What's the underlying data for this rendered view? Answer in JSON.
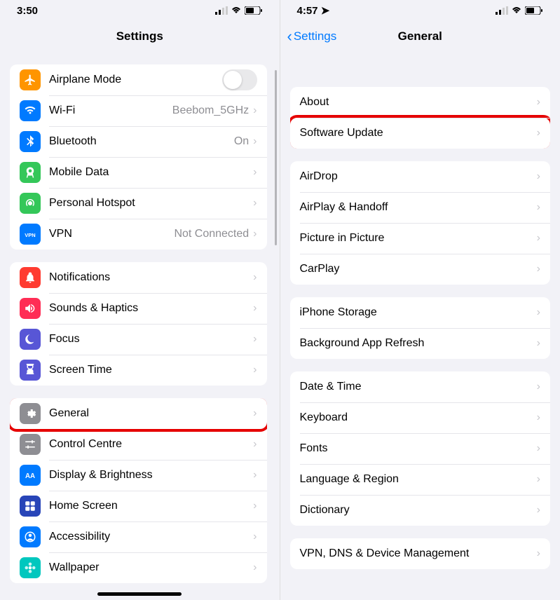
{
  "left": {
    "status_time": "3:50",
    "nav_title": "Settings",
    "groups": [
      {
        "rows": [
          {
            "key": "airplane",
            "label": "Airplane Mode",
            "icon": "airplane",
            "bg": "#ff9500",
            "control": "switch"
          },
          {
            "key": "wifi",
            "label": "Wi-Fi",
            "icon": "wifi",
            "bg": "#007aff",
            "value": "Beebom_5GHz",
            "chevron": true
          },
          {
            "key": "bluetooth",
            "label": "Bluetooth",
            "icon": "bluetooth",
            "bg": "#007aff",
            "value": "On",
            "chevron": true
          },
          {
            "key": "mobile-data",
            "label": "Mobile Data",
            "icon": "antenna",
            "bg": "#34c759",
            "chevron": true
          },
          {
            "key": "hotspot",
            "label": "Personal Hotspot",
            "icon": "hotspot",
            "bg": "#34c759",
            "chevron": true
          },
          {
            "key": "vpn",
            "label": "VPN",
            "icon": "vpn",
            "bg": "#007aff",
            "value": "Not Connected",
            "chevron": true
          }
        ]
      },
      {
        "rows": [
          {
            "key": "notifications",
            "label": "Notifications",
            "icon": "bell",
            "bg": "#ff3b30",
            "chevron": true
          },
          {
            "key": "sounds",
            "label": "Sounds & Haptics",
            "icon": "speaker",
            "bg": "#ff2d55",
            "chevron": true
          },
          {
            "key": "focus",
            "label": "Focus",
            "icon": "moon",
            "bg": "#5856d6",
            "chevron": true
          },
          {
            "key": "screen-time",
            "label": "Screen Time",
            "icon": "hourglass",
            "bg": "#5856d6",
            "chevron": true
          }
        ]
      },
      {
        "rows": [
          {
            "key": "general",
            "label": "General",
            "icon": "gear",
            "bg": "#8e8e93",
            "chevron": true,
            "highlight": true
          },
          {
            "key": "control-centre",
            "label": "Control Centre",
            "icon": "sliders",
            "bg": "#8e8e93",
            "chevron": true
          },
          {
            "key": "display",
            "label": "Display & Brightness",
            "icon": "aa",
            "bg": "#007aff",
            "chevron": true
          },
          {
            "key": "home-screen",
            "label": "Home Screen",
            "icon": "grid",
            "bg": "#2845b8",
            "chevron": true
          },
          {
            "key": "accessibility",
            "label": "Accessibility",
            "icon": "person",
            "bg": "#007aff",
            "chevron": true
          },
          {
            "key": "wallpaper",
            "label": "Wallpaper",
            "icon": "flower",
            "bg": "#00c7be",
            "chevron": true
          }
        ]
      }
    ]
  },
  "right": {
    "status_time": "4:57",
    "back_label": "Settings",
    "nav_title": "General",
    "groups": [
      {
        "rows": [
          {
            "key": "about",
            "label": "About",
            "chevron": true
          },
          {
            "key": "software-update",
            "label": "Software Update",
            "chevron": true,
            "highlight": true
          }
        ]
      },
      {
        "rows": [
          {
            "key": "airdrop",
            "label": "AirDrop",
            "chevron": true
          },
          {
            "key": "airplay",
            "label": "AirPlay & Handoff",
            "chevron": true
          },
          {
            "key": "pip",
            "label": "Picture in Picture",
            "chevron": true
          },
          {
            "key": "carplay",
            "label": "CarPlay",
            "chevron": true
          }
        ]
      },
      {
        "rows": [
          {
            "key": "storage",
            "label": "iPhone Storage",
            "chevron": true
          },
          {
            "key": "background-refresh",
            "label": "Background App Refresh",
            "chevron": true
          }
        ]
      },
      {
        "rows": [
          {
            "key": "date-time",
            "label": "Date & Time",
            "chevron": true
          },
          {
            "key": "keyboard",
            "label": "Keyboard",
            "chevron": true
          },
          {
            "key": "fonts",
            "label": "Fonts",
            "chevron": true
          },
          {
            "key": "language",
            "label": "Language & Region",
            "chevron": true
          },
          {
            "key": "dictionary",
            "label": "Dictionary",
            "chevron": true
          }
        ]
      },
      {
        "rows": [
          {
            "key": "vpn-device",
            "label": "VPN, DNS & Device Management",
            "chevron": true
          }
        ]
      }
    ]
  }
}
